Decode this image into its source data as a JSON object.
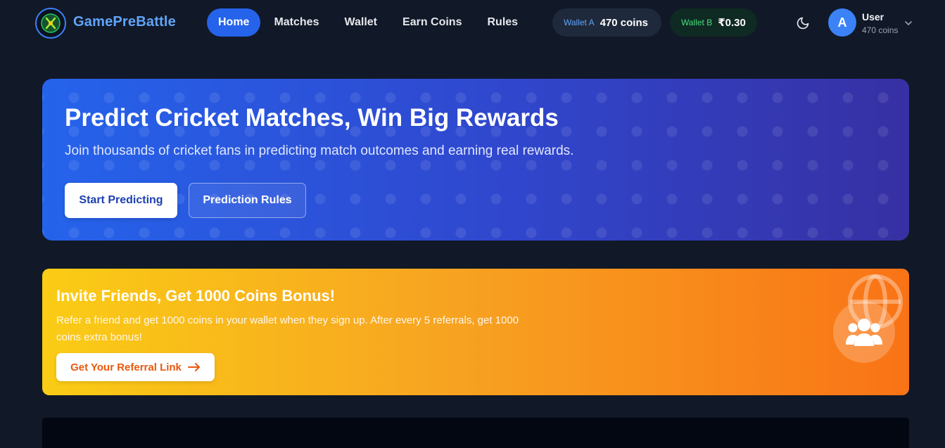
{
  "header": {
    "brand": "GamePreBattle",
    "nav": [
      {
        "label": "Home",
        "active": true
      },
      {
        "label": "Matches",
        "active": false
      },
      {
        "label": "Wallet",
        "active": false
      },
      {
        "label": "Earn Coins",
        "active": false
      },
      {
        "label": "Rules",
        "active": false
      }
    ],
    "wallet_a": {
      "label": "Wallet A",
      "value": "470 coins"
    },
    "wallet_b": {
      "label": "Wallet B",
      "value": "₹0.30"
    },
    "user": {
      "initial": "A",
      "name": "User",
      "coins": "470 coins"
    },
    "icons": {
      "theme": "moon-icon",
      "menu": "chevron-down-icon",
      "logo": "logo-icon"
    }
  },
  "hero": {
    "title": "Predict Cricket Matches, Win Big Rewards",
    "subtitle": "Join thousands of cricket fans in predicting match outcomes and earning real rewards.",
    "primary_button": "Start Predicting",
    "secondary_button": "Prediction Rules"
  },
  "referral": {
    "title": "Invite Friends, Get 1000 Coins Bonus!",
    "text": "Refer a friend and get 1000 coins in your wallet when they sign up. After every 5 referrals, get 1000 coins extra bonus!",
    "button": "Get Your Referral Link",
    "icons": {
      "globe": "globe-icon",
      "users": "users-icon",
      "arrow": "arrow-right-icon"
    }
  },
  "colors": {
    "background": "#111827",
    "accent": "#2563eb",
    "brand": "#60a5fa",
    "referral_start": "#facc15",
    "referral_end": "#f97316"
  }
}
